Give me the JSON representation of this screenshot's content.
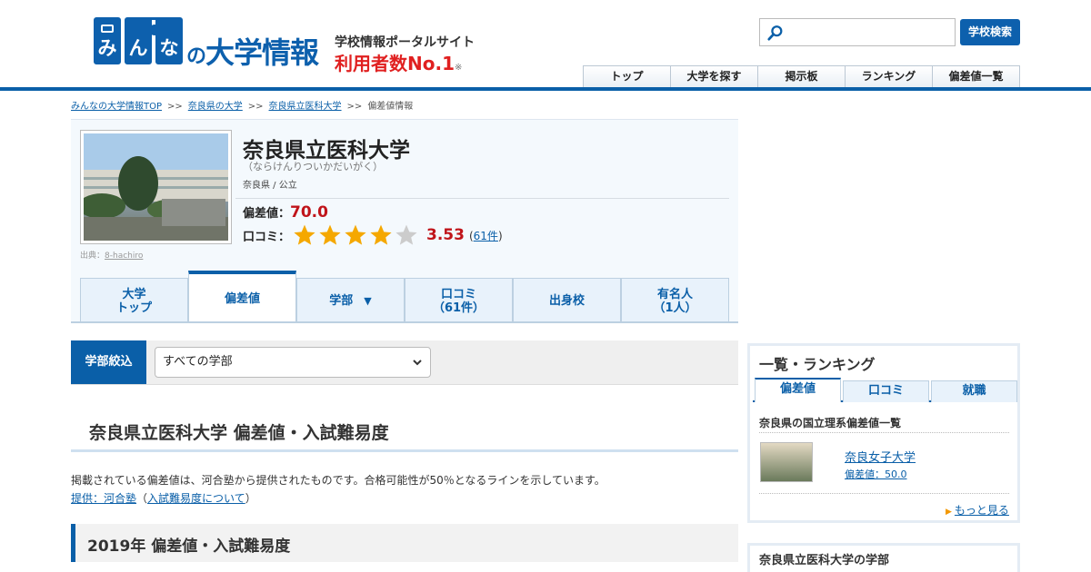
{
  "header": {
    "logo_chars": [
      "み",
      "ん",
      "な"
    ],
    "logo_suffix_no": "の",
    "logo_suffix": "大学情報",
    "tagline": "学校情報ポータルサイト",
    "tagline2": "利用者数No.1",
    "tagline2_note": "※",
    "search_placeholder": "",
    "search_button": "学校検索",
    "nav": [
      "トップ",
      "大学を探す",
      "掲示板",
      "ランキング",
      "偏差値一覧"
    ]
  },
  "breadcrumb": {
    "items": [
      "みんなの大学情報TOP",
      "奈良県の大学",
      "奈良県立医科大学"
    ],
    "separator": ">>",
    "current": "偏差値情報"
  },
  "university": {
    "name": "奈良県立医科大学",
    "kana": "（ならけんりついかだいがく）",
    "location": "奈良県 / 公立",
    "photo_credit_label": "出典：",
    "photo_credit": "8-hachiro",
    "hensa_label": "偏差値：",
    "hensa_value": "70.0",
    "review_label": "口コミ：",
    "review_score": "3.53",
    "review_rating": 3.53,
    "review_count": "61件"
  },
  "tabs": [
    {
      "line1": "大学",
      "line2": "トップ"
    },
    {
      "line1": "偏差値",
      "line2": ""
    },
    {
      "line1": "学部",
      "line2": ""
    },
    {
      "line1": "口コミ",
      "line2": "（61件）"
    },
    {
      "line1": "出身校",
      "line2": ""
    },
    {
      "line1": "有名人",
      "line2": "（1人）"
    }
  ],
  "tab_caret": "▼",
  "filter": {
    "label": "学部絞込",
    "selected": "すべての学部"
  },
  "main": {
    "heading": "奈良県立医科大学 偏差値・入試難易度",
    "lead": "掲載されている偏差値は、河合塾から提供されたものです。合格可能性が50％となるラインを示しています。",
    "source_link": "提供：河合塾",
    "source_paren_open": "（",
    "source_about": "入試難易度について",
    "source_paren_close": "）",
    "year_heading": "2019年 偏差値・入試難易度"
  },
  "sidebar": {
    "title": "一覧・ランキング",
    "tabs": [
      "偏差値",
      "口コミ",
      "就職"
    ],
    "subtitle": "奈良県の国立理系偏差値一覧",
    "item_name": "奈良女子大学",
    "item_hensa": "偏差値：50.0",
    "more": "もっと見る",
    "more_arrow": "▶",
    "section2_title": "奈良県立医科大学の学部"
  },
  "colors": {
    "brand": "#0a5fa8",
    "accent_red": "#c0141a",
    "star": "#f5a800",
    "star_empty": "#cccccc"
  }
}
